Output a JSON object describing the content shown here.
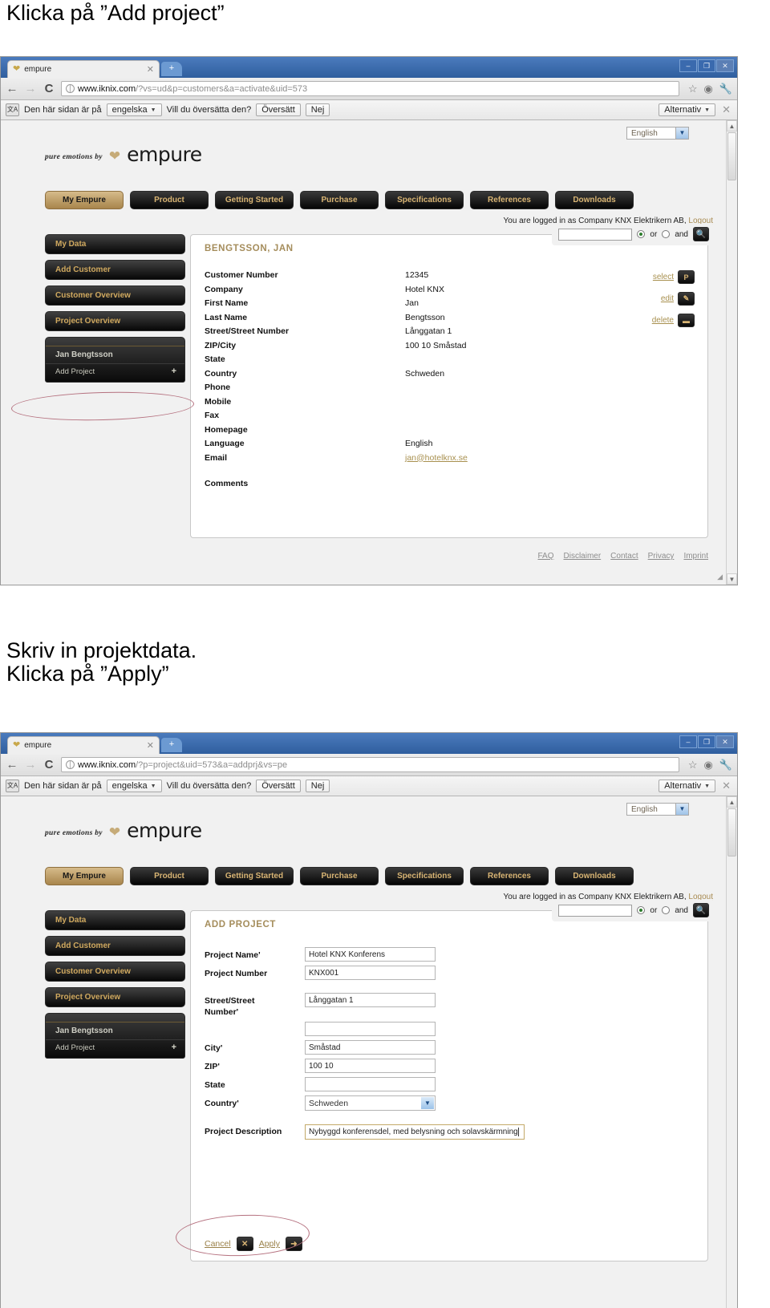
{
  "instructions": {
    "first": "Klicka på ”Add project”",
    "second_line1": "Skriv in projektdata.",
    "second_line2": "Klicka på ”Apply”"
  },
  "browser": {
    "tab_title": "empure",
    "tab_favicon_icon": "empure-heart-icon",
    "tab_close_icon": "close-icon",
    "new_tab_icon": "plus-icon",
    "window_minimize": "–",
    "window_maximize": "❐",
    "window_close": "✕",
    "back_icon": "←",
    "forward_icon": "→",
    "reload_icon": "C",
    "star_icon": "☆",
    "extension_icon": "◉",
    "wrench_icon": "🔧",
    "translate": {
      "icon": "translate-icon",
      "prefix": "Den här sidan är på",
      "language": "engelska",
      "question": "Vill du översätta den?",
      "translate_button": "Översätt",
      "no_button": "Nej",
      "options_button": "Alternativ",
      "close_icon": "✕"
    }
  },
  "shot1": {
    "url_host": "www.iknix.com",
    "url_path": "/?vs=ud&p=customers&a=activate&uid=573",
    "language_value": "English",
    "brand": {
      "tagline": "pure emotions by",
      "wordmark": "empure"
    },
    "nav": [
      {
        "label": "My Empure",
        "active": true
      },
      {
        "label": "Product",
        "active": false
      },
      {
        "label": "Getting Started",
        "active": false
      },
      {
        "label": "Purchase",
        "active": false
      },
      {
        "label": "Specifications",
        "active": false
      },
      {
        "label": "References",
        "active": false
      },
      {
        "label": "Downloads",
        "active": false
      }
    ],
    "login_text": "You are logged in as Company KNX Elektrikern AB,",
    "logout_label": "Logout",
    "sidebar": {
      "items": [
        {
          "label": "My Data"
        },
        {
          "label": "Add Customer"
        },
        {
          "label": "Customer Overview"
        },
        {
          "label": "Project Overview"
        }
      ],
      "person": "Jan Bengtsson",
      "add_project": "Add Project",
      "add_project_plus": "+"
    },
    "card_title": "BENGTSSON, JAN",
    "search": {
      "value": "",
      "or_label": "or",
      "and_label": "and",
      "search_icon": "🔍"
    },
    "details": [
      {
        "key": "Customer Number",
        "value": "12345",
        "link": false
      },
      {
        "key": "Company",
        "value": "Hotel KNX",
        "link": false
      },
      {
        "key": "First Name",
        "value": "Jan",
        "link": false
      },
      {
        "key": "Last Name",
        "value": "Bengtsson",
        "link": false
      },
      {
        "key": "Street/Street Number",
        "value": "Långgatan 1",
        "link": false
      },
      {
        "key": "ZIP/City",
        "value": "100 10 Småstad",
        "link": false
      },
      {
        "key": "State",
        "value": "",
        "link": false
      },
      {
        "key": "Country",
        "value": "Schweden",
        "link": false
      },
      {
        "key": "Phone",
        "value": "",
        "link": false
      },
      {
        "key": "Mobile",
        "value": "",
        "link": false
      },
      {
        "key": "Fax",
        "value": "",
        "link": false
      },
      {
        "key": "Homepage",
        "value": "",
        "link": false
      },
      {
        "key": "Language",
        "value": "English",
        "link": false
      },
      {
        "key": "Email",
        "value": "jan@hotelknx.se",
        "link": true
      }
    ],
    "comments_label": "Comments",
    "actions": [
      {
        "label": "select",
        "icon": "P"
      },
      {
        "label": "edit",
        "icon": "✎"
      },
      {
        "label": "delete",
        "icon": "▬"
      }
    ],
    "footer_links": [
      "FAQ",
      "Disclaimer",
      "Contact",
      "Privacy",
      "Imprint"
    ]
  },
  "shot2": {
    "url_host": "www.iknix.com",
    "url_path": "/?p=project&uid=573&a=addprj&vs=pe",
    "language_value": "English",
    "brand": {
      "tagline": "pure emotions by",
      "wordmark": "empure"
    },
    "nav": [
      {
        "label": "My Empure",
        "active": true
      },
      {
        "label": "Product",
        "active": false
      },
      {
        "label": "Getting Started",
        "active": false
      },
      {
        "label": "Purchase",
        "active": false
      },
      {
        "label": "Specifications",
        "active": false
      },
      {
        "label": "References",
        "active": false
      },
      {
        "label": "Downloads",
        "active": false
      }
    ],
    "login_text": "You are logged in as Company KNX Elektrikern AB,",
    "logout_label": "Logout",
    "sidebar": {
      "items": [
        {
          "label": "My Data"
        },
        {
          "label": "Add Customer"
        },
        {
          "label": "Customer Overview"
        },
        {
          "label": "Project Overview"
        }
      ],
      "person": "Jan Bengtsson",
      "add_project": "Add Project",
      "add_project_plus": "+"
    },
    "card_title": "ADD PROJECT",
    "search": {
      "value": "",
      "or_label": "or",
      "and_label": "and",
      "search_icon": "🔍"
    },
    "form": {
      "project_name_label": "Project Name'",
      "project_name_value": "Hotel KNX Konferens",
      "project_number_label": "Project Number",
      "project_number_value": "KNX001",
      "street_label_line1": "Street/Street",
      "street_label_line2": "Number'",
      "street_value": "Långgatan 1",
      "street2_value": "",
      "city_label": "City'",
      "city_value": "Småstad",
      "zip_label": "ZIP'",
      "zip_value": "100 10",
      "state_label": "State",
      "state_value": "",
      "country_label": "Country'",
      "country_value": "Schweden",
      "description_label": "Project Description",
      "description_value": "Nybyggd konferensdel, med belysning och solavskärmning"
    },
    "cancel_label": "Cancel",
    "cancel_icon": "✕",
    "apply_label": "Apply",
    "apply_icon": "➜"
  },
  "colors": {
    "gold": "#a88b52",
    "dark_button": "#0a0a0a",
    "annotation_red": "#b5717f"
  }
}
